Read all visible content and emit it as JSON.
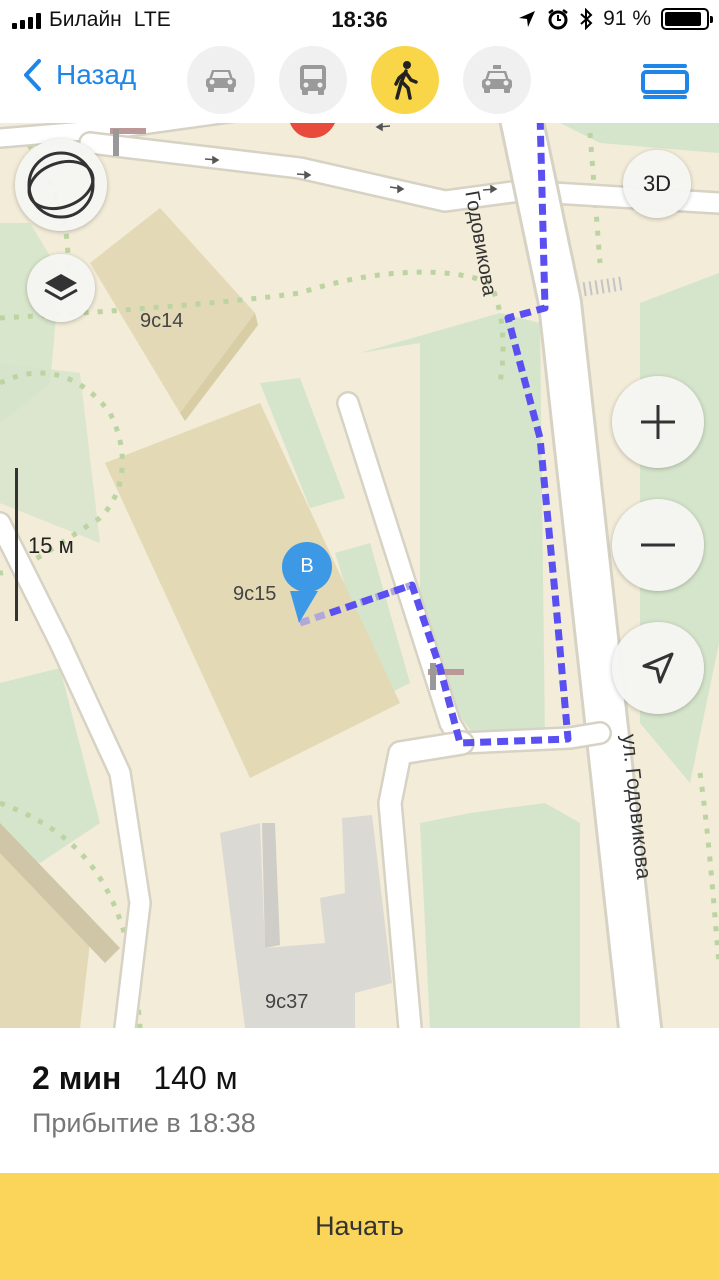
{
  "status_bar": {
    "carrier": "Билайн",
    "network": "LTE",
    "time": "18:36",
    "battery": "91 %",
    "battery_level": 0.91
  },
  "nav": {
    "back_label": "Назад",
    "modes": [
      {
        "icon": "car-icon",
        "active": false
      },
      {
        "icon": "bus-icon",
        "active": false
      },
      {
        "icon": "pedestrian-icon",
        "active": true
      },
      {
        "icon": "taxi-icon",
        "active": false
      }
    ],
    "route_list_icon": "route-list-icon"
  },
  "map": {
    "buildings": [
      "9с14",
      "9с15",
      "9с37"
    ],
    "streets": [
      "Годовикова",
      "ул. Годовикова"
    ],
    "scale": "15 м",
    "destination_marker": "B",
    "buttons": {
      "view_3d": "3D",
      "compass_icon": "compass-icon",
      "layers_icon": "layers-icon",
      "zoom_in_icon": "plus-icon",
      "zoom_out_icon": "minus-icon",
      "locate_icon": "location-arrow-icon"
    },
    "route_color": "#5a4ff0"
  },
  "summary": {
    "duration": "2 мин",
    "distance": "140 м",
    "arrival": "Прибытие в 18:38"
  },
  "start_button": "Начать",
  "colors": {
    "accent": "#fad55a",
    "link": "#1e86e8",
    "marker": "#3d98e6"
  }
}
